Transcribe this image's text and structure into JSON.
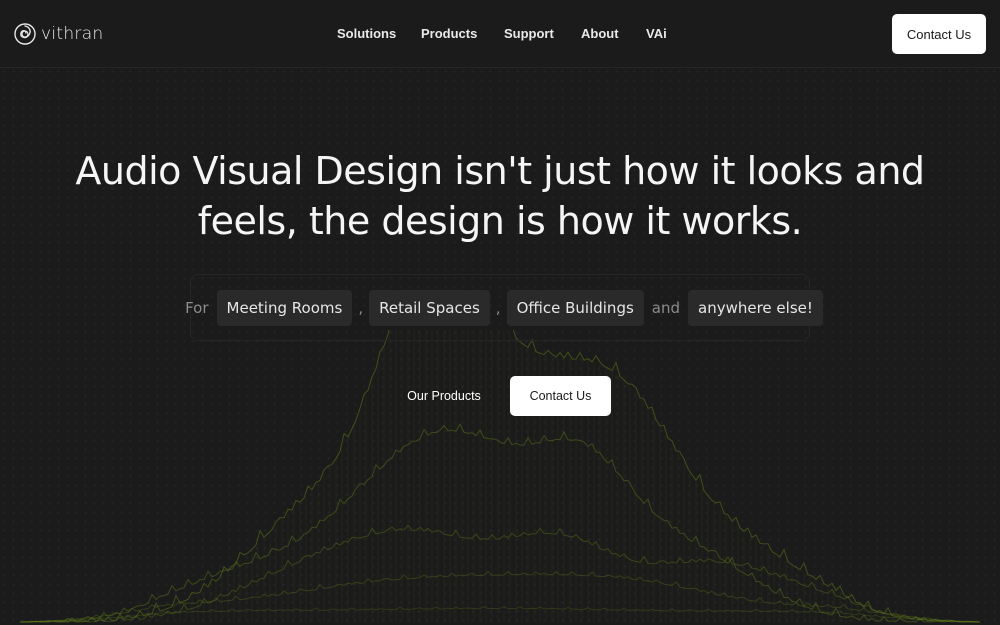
{
  "brand": {
    "name": "vithran",
    "logo_icon": "swirl-logo-icon"
  },
  "nav": {
    "items": [
      {
        "label": "Solutions"
      },
      {
        "label": "Products"
      },
      {
        "label": "Support"
      },
      {
        "label": "About"
      },
      {
        "label": "VAi"
      }
    ],
    "cta_label": "Contact Us"
  },
  "hero": {
    "title_line1": "Audio Visual Design isn't just how it looks and",
    "title_line2": "feels, the design is how it works.",
    "for_label": "For",
    "chips": [
      "Meeting Rooms",
      "Retail Spaces",
      "Office Buildings"
    ],
    "separator": ",",
    "and_label": "and",
    "last_chip": "anywhere else!",
    "primary_button": "Our Products",
    "secondary_button": "Contact Us"
  },
  "colors": {
    "background": "#1b1b1b",
    "terrain_lines": "#5f7a1c",
    "button_bg": "#ffffff"
  }
}
